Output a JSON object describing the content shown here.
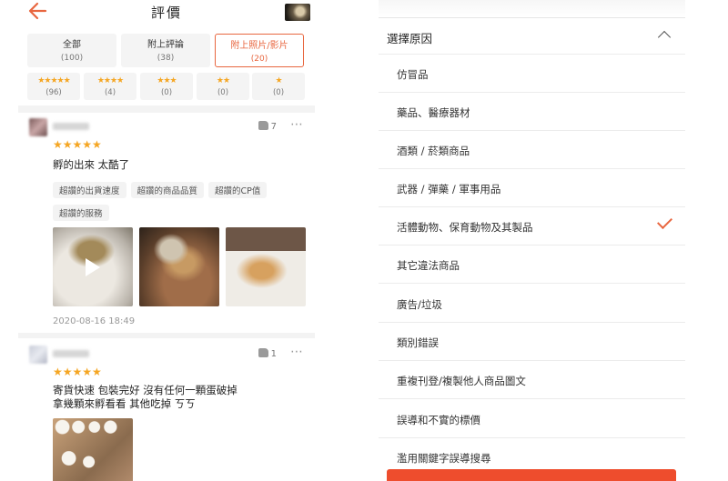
{
  "header": {
    "title": "評價"
  },
  "filters": [
    {
      "label": "全部",
      "count": "(100)",
      "selected": false
    },
    {
      "label": "附上評論",
      "count": "(38)",
      "selected": false
    },
    {
      "label": "附上照片/影片",
      "count": "(20)",
      "selected": true
    }
  ],
  "star_filters": [
    {
      "stars": "★★★★★",
      "count": "(96)"
    },
    {
      "stars": "★★★★",
      "count": "(4)"
    },
    {
      "stars": "★★★",
      "count": "(0)"
    },
    {
      "stars": "★★",
      "count": "(0)"
    },
    {
      "stars": "★",
      "count": "(0)"
    }
  ],
  "reviews": [
    {
      "likes": "7",
      "stars": "★★★★★",
      "text": "孵的出來 太酷了",
      "tags": [
        "超讚的出貨速度",
        "超讚的商品品質",
        "超讚的CP值",
        "超讚的服務"
      ],
      "date": "2020-08-16 18:49"
    },
    {
      "likes": "1",
      "stars": "★★★★★",
      "text_line1": "寄貨快速 包裝完好 沒有任何一顆蛋破掉",
      "text_line2": "拿幾顆來孵看看 其他吃掉 ㄎㄎ"
    }
  ],
  "more_icon": "⋯",
  "report_sheet": {
    "title": "選擇原因",
    "reasons": [
      {
        "label": "仿冒品",
        "checked": false
      },
      {
        "label": "藥品、醫療器材",
        "checked": false
      },
      {
        "label": "酒類 / 菸類商品",
        "checked": false
      },
      {
        "label": "武器 / 彈藥 / 軍事用品",
        "checked": false
      },
      {
        "label": "活體動物、保育動物及其製品",
        "checked": true
      },
      {
        "label": "其它違法商品",
        "checked": false
      },
      {
        "label": "廣告/垃圾",
        "checked": false
      },
      {
        "label": "類別錯誤",
        "checked": false
      },
      {
        "label": "重複刊登/複製他人商品圖文",
        "checked": false
      },
      {
        "label": "誤導和不實的標價",
        "checked": false
      },
      {
        "label": "濫用關鍵字誤導搜尋",
        "checked": false
      }
    ]
  },
  "colors": {
    "accent": "#e8663f",
    "star": "#f5a623",
    "submit": "#ee4d2d"
  }
}
